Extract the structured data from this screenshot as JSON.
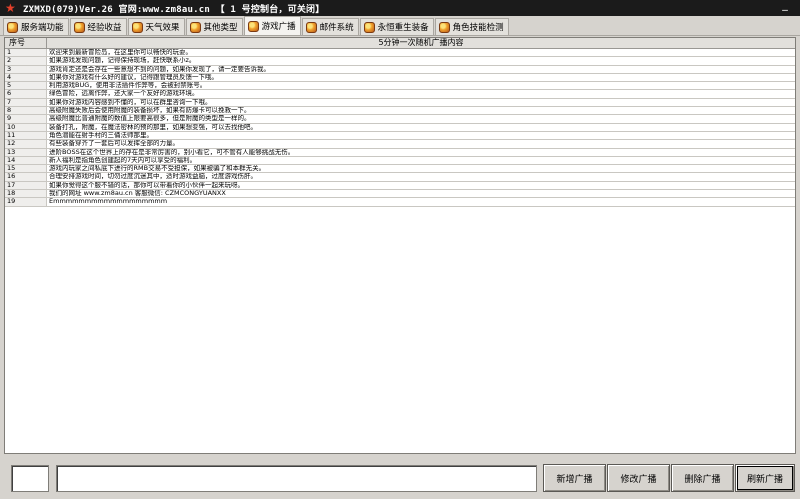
{
  "window": {
    "title": "ZXMXD(079)Ver.26 官网:www.zm8au.cn 【 1 号控制台，可关闭】",
    "minimize_glyph": "_"
  },
  "tabs": [
    {
      "label": "服务端功能",
      "icon": "gear-icon"
    },
    {
      "label": "经验收益",
      "icon": "gear-icon"
    },
    {
      "label": "天气效果",
      "icon": "gear-icon"
    },
    {
      "label": "其他类型",
      "icon": "gear-icon"
    },
    {
      "label": "游戏广播",
      "icon": "gear-icon",
      "active": true
    },
    {
      "label": "邮件系统",
      "icon": "gear-icon"
    },
    {
      "label": "永恒重生装备",
      "icon": "gear-icon"
    },
    {
      "label": "角色技能检测",
      "icon": "gear-icon"
    }
  ],
  "table": {
    "headers": {
      "no": "序号",
      "content": "5分钟一次随机广播内容"
    },
    "rows": [
      {
        "no": "1",
        "content": "欢迎来到最新冒险岛，在这里你可以畅快的玩耍。"
      },
      {
        "no": "2",
        "content": "如果游戏发现问题，记得保持现场，赶快联系小z。"
      },
      {
        "no": "3",
        "content": "游戏肯定还是会存在一些意想不到的问题，如果你发现了，请一定要告诉我。"
      },
      {
        "no": "4",
        "content": "如果你对游戏有什么好的建议，记得跟管理员反馈一下哦。"
      },
      {
        "no": "5",
        "content": "利用游戏BUG，使用非法插件作弊等，会被封禁账号。"
      },
      {
        "no": "6",
        "content": "绿色冒险，远离作弊，还大家一个友好的游戏环境。"
      },
      {
        "no": "7",
        "content": "如果你对游戏内容感到不懂的，可以在群里咨询一下哦。"
      },
      {
        "no": "8",
        "content": "高级附魔失败后会使用附魔的装备损坏，如果有防爆卡可以挽救一下。"
      },
      {
        "no": "9",
        "content": "高级附魔比普通附魔的数值上限要高很多，但是附魔的类型是一样的。"
      },
      {
        "no": "10",
        "content": "装备打孔，附魔，在魔法密林的预的那里，如果想变强，可以去找他吧。"
      },
      {
        "no": "11",
        "content": "角色潜能在射手村的三俑法师那里。"
      },
      {
        "no": "12",
        "content": "有些装备穿齐了一套后可以发挥全部的力量。"
      },
      {
        "no": "13",
        "content": "进阶BOSS在这个世界上的存在是非常厉害的，别小看它，可不管有人能够挑战无伤。"
      },
      {
        "no": "14",
        "content": "新人福利是指角色创建起的7天内可以享受的福利。"
      },
      {
        "no": "15",
        "content": "游戏内玩家之间私底下进行的RMB交易不受担保，如果被骗了和本群无关。"
      },
      {
        "no": "16",
        "content": "合理安排游戏时间，切勿过度沉迷其中，适时游戏益脑，过度游戏伤肝。"
      },
      {
        "no": "17",
        "content": "如果你觉得这个服不错的话，那你可以带着你的小伙伴一起来玩呀。"
      },
      {
        "no": "18",
        "content": "我们的网址 www.zm8au.cn  客服微信: CZMCONGYUANXX"
      },
      {
        "no": "19",
        "content": "Emmmmmmmmmmmmmmmmmm"
      }
    ]
  },
  "footer": {
    "id_value": "",
    "content_value": "",
    "buttons": {
      "add": "新增广播",
      "edit": "修改广播",
      "delete": "删除广播",
      "refresh": "刷新广播"
    }
  }
}
